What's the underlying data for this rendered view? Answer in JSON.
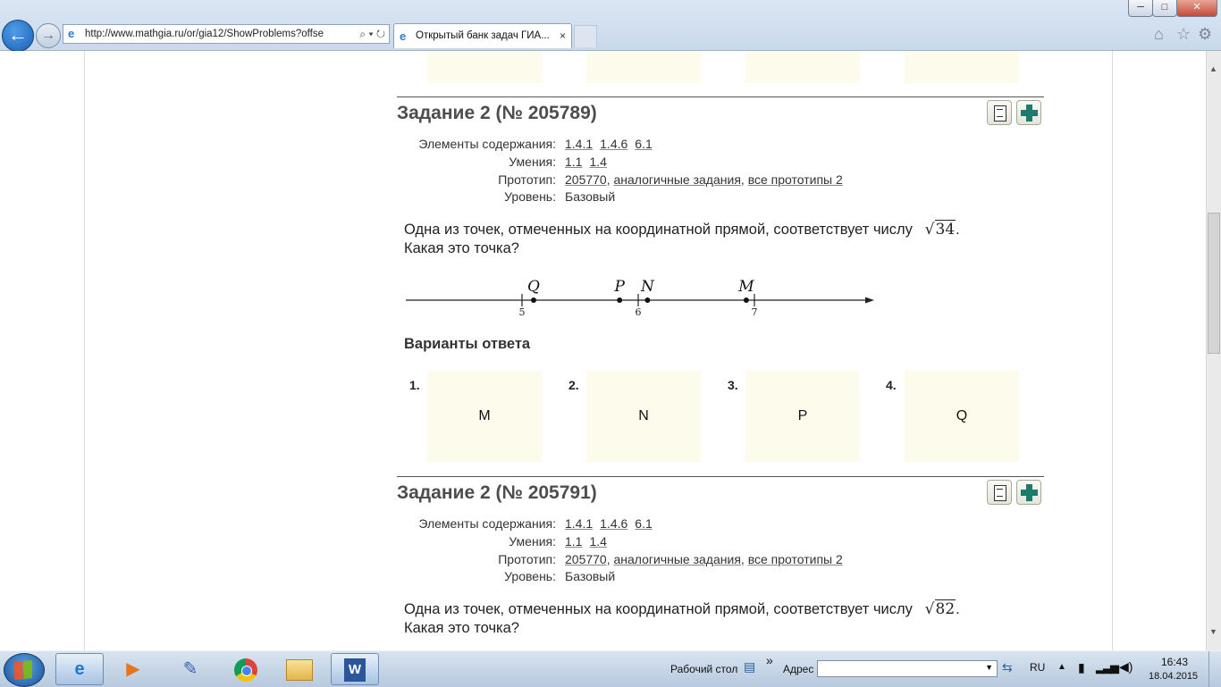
{
  "browser": {
    "url": "http://www.mathgia.ru/or/gia12/ShowProblems?offse",
    "tab_title": "Открытый банк задач ГИА...",
    "tab_close": "×",
    "back_glyph": "←",
    "forward_glyph": "→",
    "search_glyph": "⌕",
    "dropdown_glyph": "▾",
    "refresh_glyph": "↻",
    "minimize": "─",
    "maximize": "□",
    "close": "✕",
    "home_glyph": "⌂",
    "favorites_glyph": "☆",
    "tools_glyph": "⚙"
  },
  "problems": [
    {
      "title": "Задание 2 (№ 205789)",
      "content_label": "Элементы содержания:",
      "content_links": [
        "1.4.1",
        "1.4.6",
        "6.1"
      ],
      "skills_label": "Умения:",
      "skills_links": [
        "1.1",
        "1.4"
      ],
      "prototype_label": "Прототип:",
      "prototype_links": [
        "205770",
        "аналогичные задания",
        "все прототипы 2"
      ],
      "level_label": "Уровень:",
      "level_value": "Базовый",
      "question_text": "Одна из точек, отмеченных на координатной прямой, соответствует числу",
      "sqrt_radicand": "34",
      "question_line2": "Какая это точка?",
      "number_line": {
        "ticks": [
          5,
          6,
          7
        ],
        "points": [
          {
            "label": "Q",
            "value": 5.1
          },
          {
            "label": "P",
            "value": 5.84
          },
          {
            "label": "N",
            "value": 6.08
          },
          {
            "label": "M",
            "value": 6.93
          }
        ]
      },
      "variants_heading": "Варианты ответа",
      "answers": [
        {
          "num": "1.",
          "value": "M"
        },
        {
          "num": "2.",
          "value": "N"
        },
        {
          "num": "3.",
          "value": "P"
        },
        {
          "num": "4.",
          "value": "Q"
        }
      ]
    },
    {
      "title": "Задание 2 (№ 205791)",
      "content_label": "Элементы содержания:",
      "content_links": [
        "1.4.1",
        "1.4.6",
        "6.1"
      ],
      "skills_label": "Умения:",
      "skills_links": [
        "1.1",
        "1.4"
      ],
      "prototype_label": "Прототип:",
      "prototype_links": [
        "205770",
        "аналогичные задания",
        "все прототипы 2"
      ],
      "level_label": "Уровень:",
      "level_value": "Базовый",
      "question_text": "Одна из точек, отмеченных на координатной прямой, соответствует числу",
      "sqrt_radicand": "82",
      "question_line2": "Какая это точка?"
    }
  ],
  "taskbar": {
    "desktop_label": "Рабочий стол",
    "chevron": "»",
    "address_label": "Адрес",
    "language": "RU",
    "time": "16:43",
    "date": "18.04.2015",
    "apps": [
      "ie-icon",
      "media-player-icon",
      "paint-icon",
      "chrome-icon",
      "explorer-icon",
      "word-icon"
    ]
  }
}
